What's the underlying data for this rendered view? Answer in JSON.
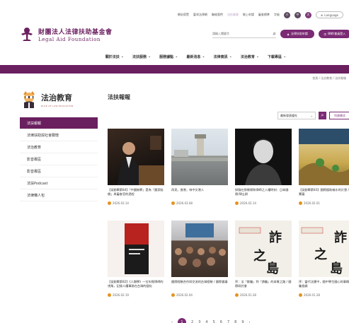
{
  "topbar": {
    "links": [
      "網站導覽",
      "臺灣法律網",
      "聯絡我們",
      "法扶資源",
      "線上申請",
      "審查標準"
    ],
    "font_size_label": "字級",
    "font_sizes": [
      "小",
      "中",
      "大"
    ],
    "language_label": "Language"
  },
  "header": {
    "org_name_zh": "財團法人法律扶助基金會",
    "org_name_en": "Legal Aid Foundation",
    "search_placeholder": "請輸入關鍵字",
    "btn_apply": "法律扶助申請",
    "btn_member": "律師/會員登入"
  },
  "nav": [
    "關於法扶",
    "法扶服務",
    "服務據點",
    "最新消息",
    "法律資訊",
    "法治教育",
    "下載專區"
  ],
  "breadcrumb": "首頁 / 法治教育 / 法扶報報",
  "sidebar": {
    "title": "法治教育",
    "subtitle": "RULE OF LAW EDUCATION",
    "items": [
      "法扶報報",
      "法律扶助與社會關懷",
      "法治教育",
      "影音專區",
      "影音專區",
      "法扶Podcast",
      "法律懶人包"
    ]
  },
  "main": {
    "title": "法扶報報",
    "sort_label": "最新發表優先",
    "view_label": "列表模式"
  },
  "cards": [
    {
      "title": "【吳劉舉第84】「中國無罪」是為「國家賠償」與審查官的過程",
      "date": "2026.03.14"
    },
    {
      "title": "再見，香港，林中文港人",
      "date": "2026.03.08"
    },
    {
      "title": "探險在那條線和律師之人權時刻：日本國際/律士群",
      "date": "2026.02.14"
    },
    {
      "title": "【吳劉舉第83】國際援助縮水的災害 / 影響篇",
      "date": "2026.02.01"
    },
    {
      "title": "【吳劉舉第82】《人類學》一位年輕律師的視角，記錄人權事務在台灣的變化",
      "date": "2026.02.19"
    },
    {
      "title": "國際經驗合作與交流的台灣經驗 / 國際會議",
      "date": "2026.02.04"
    },
    {
      "title": "序：法「欺騙」到「誘騙」的本質之路 / 國際研討會",
      "date": "2026.01.28"
    },
    {
      "title": "序：當代法匯中，國中學生國心的事情 / 詐騙島嶼",
      "date": "2026.01.28"
    }
  ],
  "pagination": [
    "1",
    "2",
    "3",
    "4",
    "5",
    "6",
    "7",
    "8",
    "9"
  ],
  "colors": {
    "brand": "#6a1f5f",
    "accent": "#7b2a74",
    "date_dot": "#e59420"
  }
}
